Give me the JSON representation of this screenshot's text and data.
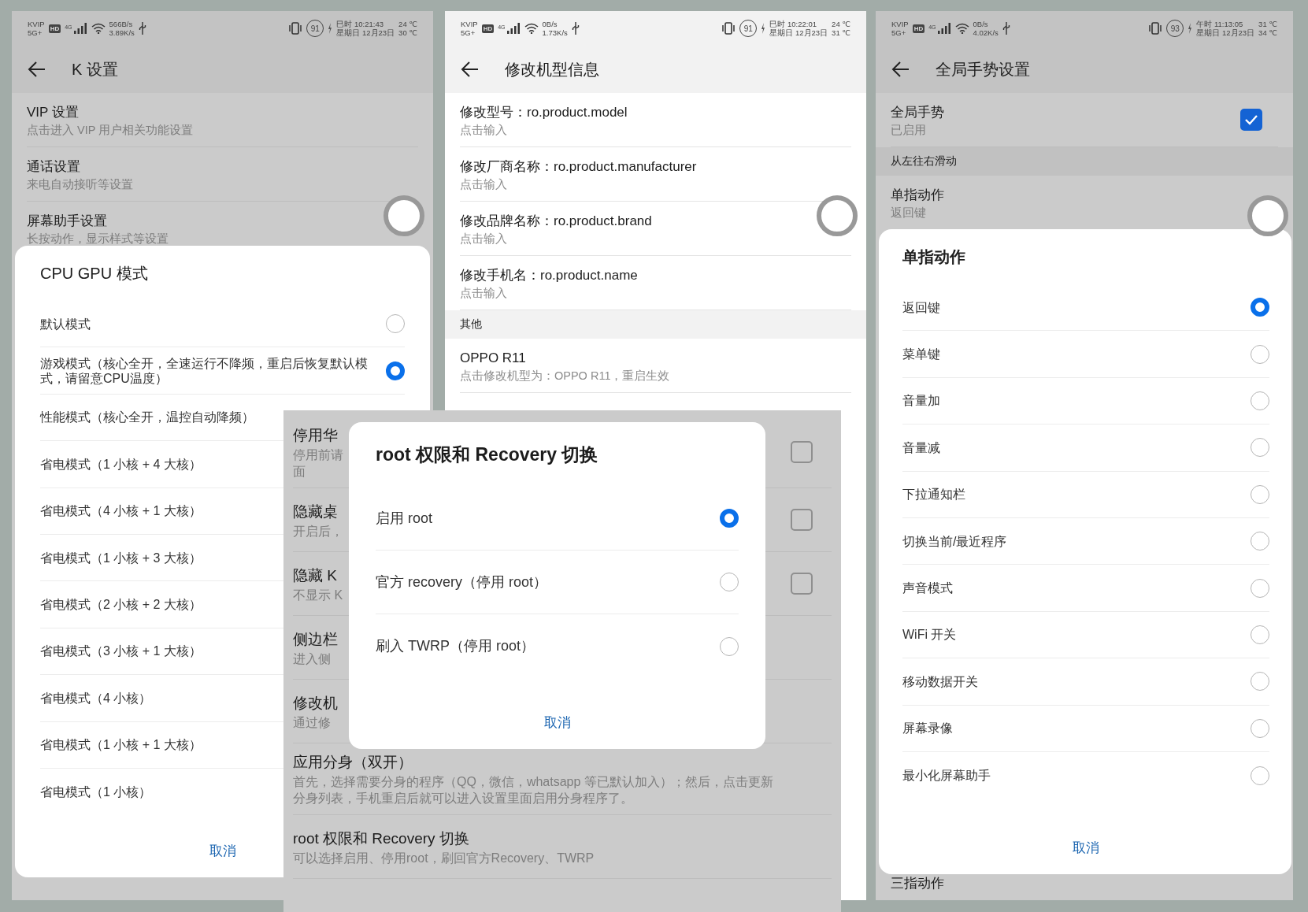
{
  "screens": [
    {
      "dimmed": true,
      "floating_ball": true,
      "status_bar": {
        "carrier": "KVIP",
        "network": "5G+",
        "hd": "HD",
        "signal_label": "4G",
        "speed_1": "566B/s",
        "speed_2": "3.89K/s",
        "battery": "91",
        "time": "巳时 10:21:43",
        "date": "星期日 12月23日",
        "temperature_1": "24 ℃",
        "temperature_2": "30 ℃"
      },
      "title": "K 设置",
      "items": [
        {
          "kind": "row",
          "title": "VIP 设置",
          "subtitle": "点击进入 VIP 用户相关功能设置"
        },
        {
          "kind": "row",
          "title": "通话设置",
          "subtitle": "来电自动接听等设置"
        },
        {
          "kind": "row",
          "title": "屏幕助手设置",
          "subtitle": "长按动作，显示样式等设置"
        }
      ],
      "dialog": {
        "title": "CPU GPU 模式",
        "options": [
          {
            "label": "默认模式",
            "selected": false
          },
          {
            "label": "游戏模式（核心全开，全速运行不降频，重启后恢复默认模式，请留意CPU温度）",
            "selected": true
          },
          {
            "label": "性能模式（核心全开，温控自动降频）"
          },
          {
            "label": "省电模式（1 小核 + 4 大核）"
          },
          {
            "label": "省电模式（4 小核 + 1 大核）"
          },
          {
            "label": "省电模式（1 小核 + 3 大核）"
          },
          {
            "label": "省电模式（2 小核 + 2 大核）"
          },
          {
            "label": "省电模式（3 小核 + 1 大核）"
          },
          {
            "label": "省电模式（4 小核）"
          },
          {
            "label": "省电模式（1 小核 + 1 大核）"
          },
          {
            "label": "省电模式（1 小核）"
          }
        ],
        "cancel": "取消"
      }
    },
    {
      "dimmed": false,
      "floating_ball": true,
      "status_bar": {
        "carrier": "KVIP",
        "network": "5G+",
        "hd": "HD",
        "signal_label": "4G",
        "speed_1": "0B/s",
        "speed_2": "1.73K/s",
        "battery": "91",
        "time": "巳时 10:22:01",
        "date": "星期日 12月23日",
        "temperature_1": "24 ℃",
        "temperature_2": "31 ℃"
      },
      "title": "修改机型信息",
      "items": [
        {
          "kind": "row",
          "title": "修改型号：ro.product.model",
          "subtitle": "点击输入"
        },
        {
          "kind": "row",
          "title": "修改厂商名称：ro.product.manufacturer",
          "subtitle": "点击输入"
        },
        {
          "kind": "row",
          "title": "修改品牌名称：ro.product.brand",
          "subtitle": "点击输入"
        },
        {
          "kind": "row",
          "title": "修改手机名：ro.product.name",
          "subtitle": "点击输入"
        },
        {
          "kind": "section",
          "title": "其他"
        },
        {
          "kind": "row",
          "title": "OPPO R11",
          "subtitle": "点击修改机型为：OPPO R11，重启生效"
        }
      ]
    },
    {
      "dimmed": true,
      "floating_ball": false,
      "items": [
        {
          "kind": "row",
          "title": "停用华",
          "subtitle": "停用前请",
          "subtitle_2": "面",
          "checked": false
        },
        {
          "kind": "row",
          "title": "隐藏桌",
          "subtitle": "开启后，",
          "checked": false
        },
        {
          "kind": "row",
          "title": "隐藏 K",
          "subtitle": "不显示 K",
          "checked": false
        },
        {
          "kind": "row",
          "title": "侧边栏",
          "subtitle": "进入侧"
        },
        {
          "kind": "row",
          "title": "修改机",
          "subtitle": "通过修"
        },
        {
          "kind": "row",
          "title": "应用分身（双开）",
          "subtitle": "首先，选择需要分身的程序（QQ，微信，whatsapp 等已默认加入）；然后，点击更新分身列表，手机重启后就可以进入设置里面启用分身程序了。"
        },
        {
          "kind": "row",
          "title": "root 权限和 Recovery 切换",
          "subtitle": "可以选择启用、停用root，刷回官方Recovery、TWRP"
        }
      ],
      "dialog": {
        "title": "root 权限和 Recovery 切换",
        "options": [
          {
            "label": "启用 root",
            "selected": true
          },
          {
            "label": "官方 recovery（停用 root）",
            "selected": false
          },
          {
            "label": "刷入 TWRP（停用 root）",
            "selected": false
          }
        ],
        "cancel": "取消"
      }
    },
    {
      "dimmed": true,
      "floating_ball": true,
      "status_bar": {
        "carrier": "KVIP",
        "network": "5G+",
        "hd": "HD",
        "signal_label": "4G",
        "speed_1": "0B/s",
        "speed_2": "4.02K/s",
        "battery": "93",
        "time": "午时 11:13:05",
        "date": "星期日 12月23日",
        "temperature_1": "31 ℃",
        "temperature_2": "34 ℃"
      },
      "title": "全局手势设置",
      "items": [
        {
          "kind": "row",
          "title": "全局手势",
          "subtitle": "已启用",
          "checked": true
        },
        {
          "kind": "section",
          "title": "从左往右滑动"
        },
        {
          "kind": "row",
          "title": "单指动作",
          "subtitle": "返回键"
        },
        {
          "kind": "row",
          "title": "三指动作"
        }
      ],
      "dialog": {
        "title": "单指动作",
        "options": [
          {
            "label": "返回键",
            "selected": true
          },
          {
            "label": "菜单键",
            "selected": false
          },
          {
            "label": "音量加",
            "selected": false
          },
          {
            "label": "音量减",
            "selected": false
          },
          {
            "label": "下拉通知栏",
            "selected": false
          },
          {
            "label": "切换当前/最近程序",
            "selected": false
          },
          {
            "label": "声音模式",
            "selected": false
          },
          {
            "label": "WiFi 开关",
            "selected": false
          },
          {
            "label": "移动数据开关",
            "selected": false
          },
          {
            "label": "屏幕录像",
            "selected": false
          },
          {
            "label": "最小化屏幕助手",
            "selected": false
          }
        ],
        "cancel": "取消"
      }
    }
  ]
}
